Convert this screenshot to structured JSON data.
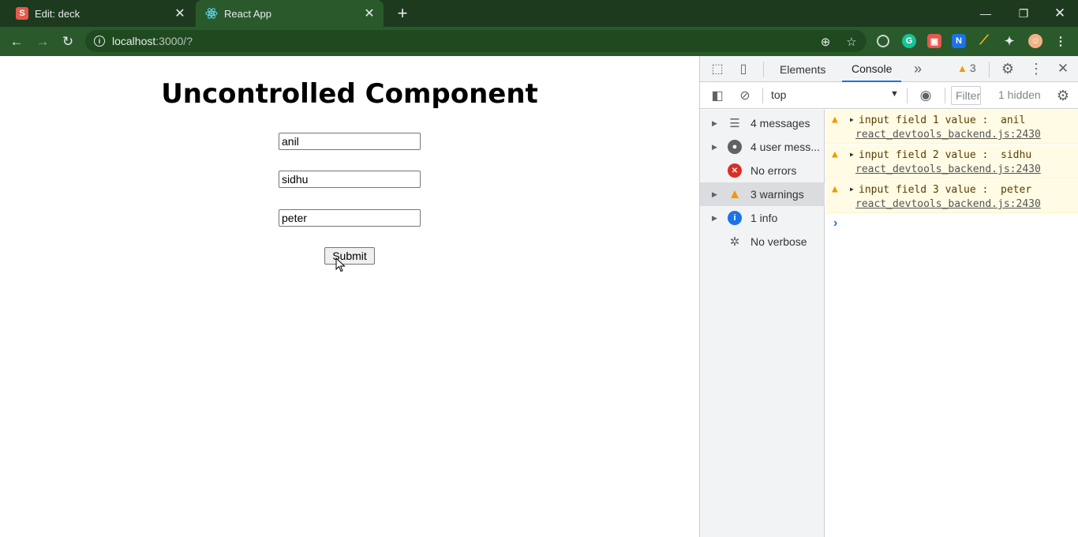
{
  "browser": {
    "tabs": [
      {
        "title": "Edit: deck",
        "favicon": "S"
      },
      {
        "title": "React App",
        "favicon": "react-logo"
      }
    ],
    "url_host": "localhost",
    "url_rest": ":3000/?"
  },
  "page": {
    "heading": "Uncontrolled Component",
    "inputs": [
      "anil",
      "sidhu",
      "peter"
    ],
    "submit_label": "Submit"
  },
  "devtools": {
    "tabs": {
      "elements": "Elements",
      "console": "Console"
    },
    "warning_count": "3",
    "context": "top",
    "filter_placeholder": "Filter",
    "hidden": "1 hidden",
    "sidebar": [
      {
        "label": "4 messages",
        "icon": "list-icon"
      },
      {
        "label": "4 user mess...",
        "icon": "user-icon"
      },
      {
        "label": "No errors",
        "icon": "error-icon"
      },
      {
        "label": "3 warnings",
        "icon": "warning-icon"
      },
      {
        "label": "1 info",
        "icon": "info-icon"
      },
      {
        "label": "No verbose",
        "icon": "bug-icon"
      }
    ],
    "messages": [
      {
        "text": "input field 1 value :  anil",
        "source": "react_devtools_backend.js:2430"
      },
      {
        "text": "input field 2 value :  sidhu",
        "source": "react_devtools_backend.js:2430"
      },
      {
        "text": "input field 3 value :  peter",
        "source": "react_devtools_backend.js:2430"
      }
    ]
  }
}
